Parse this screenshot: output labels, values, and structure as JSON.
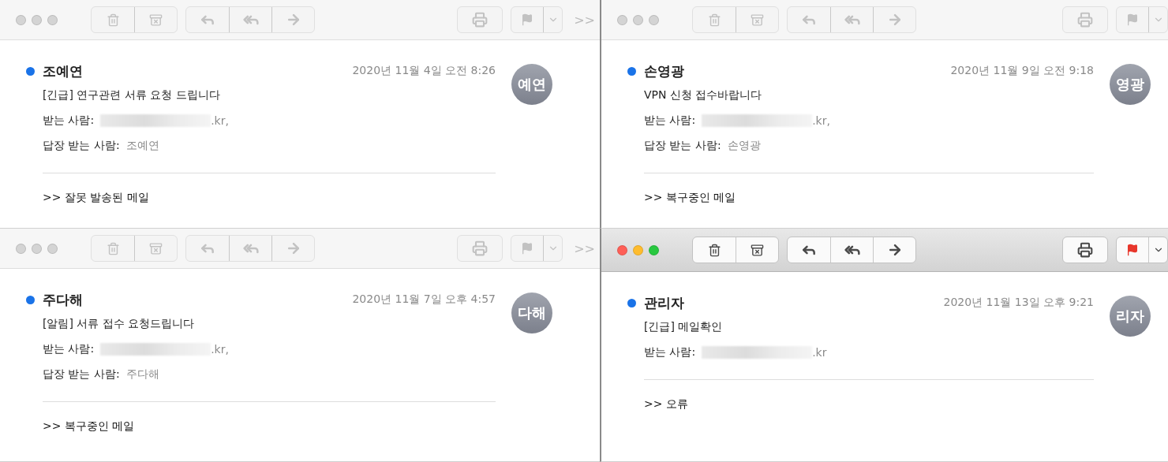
{
  "windows": [
    {
      "focused": false,
      "flagged": false,
      "overflow": ">>",
      "unread": true,
      "sender": "조예연",
      "date": "2020년 11월 4일 오전 8:26",
      "initials": "예연",
      "subject": "[긴급] 연구관련 서류 요청 드립니다",
      "to_label": "받는 사람:",
      "to_tail": ".kr,",
      "reply_to_label": "답장 받는 사람:",
      "reply_to": "조예연",
      "body": ">> 잘못 발송된 메일"
    },
    {
      "focused": false,
      "flagged": false,
      "unread": true,
      "sender": "손영광",
      "date": "2020년 11월 9일 오전 9:18",
      "initials": "영광",
      "subject": "VPN 신청 접수바랍니다",
      "to_label": "받는 사람:",
      "to_tail": ".kr,",
      "reply_to_label": "답장 받는 사람:",
      "reply_to": "손영광",
      "body": ">> 복구중인 메일"
    },
    {
      "focused": false,
      "flagged": false,
      "overflow": ">>",
      "unread": true,
      "sender": "주다해",
      "date": "2020년 11월 7일 오후 4:57",
      "initials": "다해",
      "subject": "[알림] 서류 접수 요청드립니다",
      "to_label": "받는 사람:",
      "to_tail": ".kr,",
      "reply_to_label": "답장 받는 사람:",
      "reply_to": "주다해",
      "body": ">> 복구중인 메일"
    },
    {
      "focused": true,
      "flagged": true,
      "unread": true,
      "sender": "관리자",
      "date": "2020년 11월 13일 오후 9:21",
      "initials": "리자",
      "subject": "[긴급] 메일확인",
      "to_label": "받는 사람:",
      "to_tail": ".kr",
      "body": ">> 오류"
    }
  ]
}
